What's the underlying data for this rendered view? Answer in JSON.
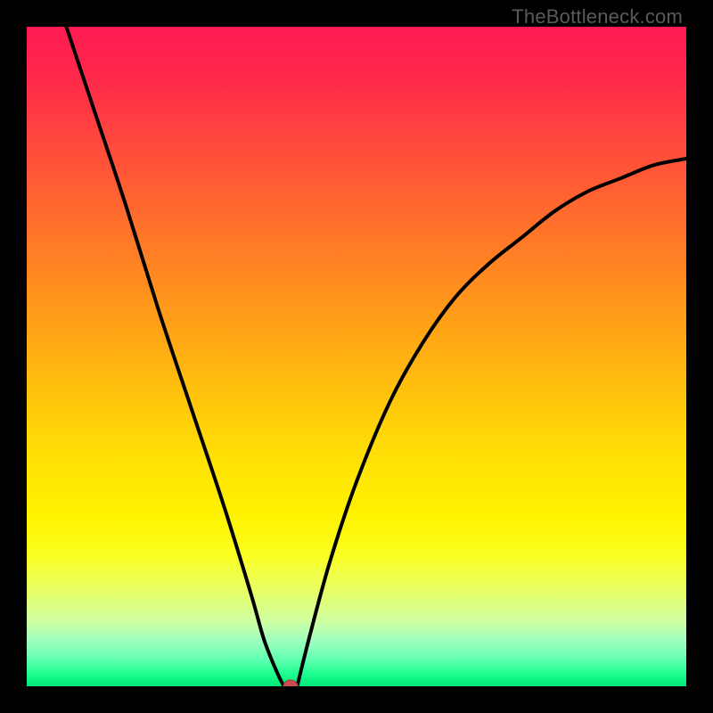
{
  "watermark": "TheBottleneck.com",
  "chart_data": {
    "type": "line",
    "title": "",
    "xlabel": "",
    "ylabel": "",
    "xlim": [
      0,
      100
    ],
    "ylim": [
      0,
      100
    ],
    "grid": false,
    "left_branch": {
      "x": [
        6,
        10,
        15,
        20,
        25,
        30,
        34,
        36,
        38,
        39
      ],
      "values": [
        100,
        88,
        73,
        57,
        42,
        27,
        14,
        7,
        2,
        0
      ]
    },
    "right_branch": {
      "x": [
        41,
        43,
        46,
        50,
        55,
        60,
        65,
        70,
        75,
        80,
        85,
        90,
        95,
        100
      ],
      "values": [
        0,
        8,
        19,
        31,
        43,
        52,
        59,
        64,
        68,
        72,
        75,
        77,
        79,
        80
      ]
    },
    "marker": {
      "x": 40,
      "y": 0,
      "color": "#c94f4f"
    },
    "background_gradient": {
      "top": "#ff1a52",
      "mid": "#ffe600",
      "bottom": "#00e878"
    }
  }
}
